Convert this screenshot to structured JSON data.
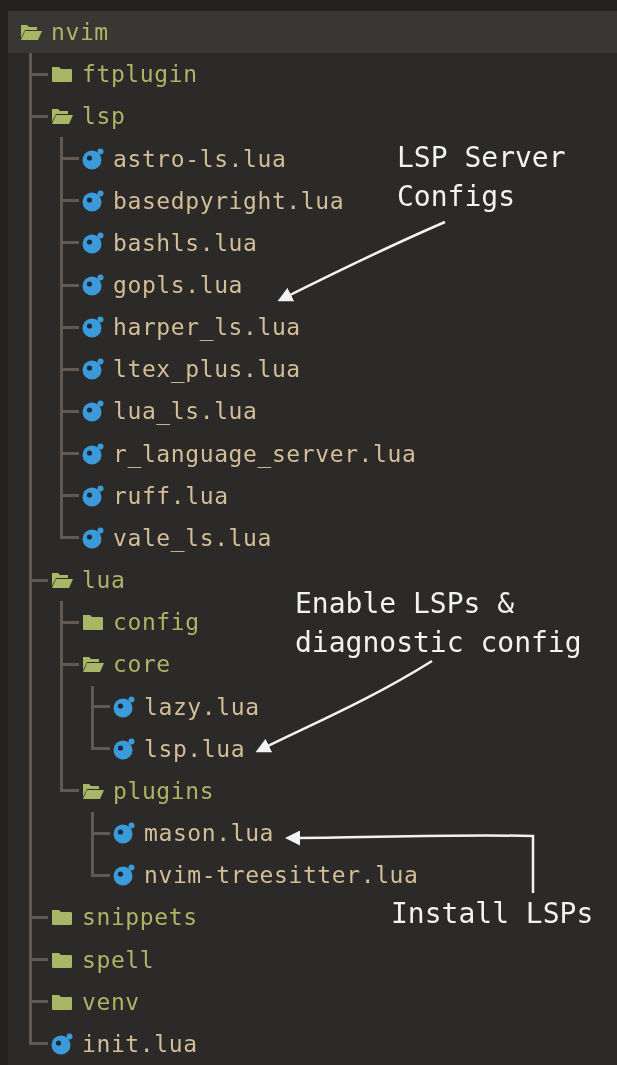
{
  "tree": {
    "name": "nvim",
    "kind": "folder",
    "expanded": true,
    "selected": true,
    "children": [
      {
        "name": "ftplugin",
        "kind": "folder",
        "expanded": false,
        "selected": false
      },
      {
        "name": "lsp",
        "kind": "folder",
        "expanded": true,
        "selected": false,
        "children": [
          {
            "name": "astro-ls.lua",
            "kind": "file",
            "selected": false
          },
          {
            "name": "basedpyright.lua",
            "kind": "file",
            "selected": false
          },
          {
            "name": "bashls.lua",
            "kind": "file",
            "selected": false
          },
          {
            "name": "gopls.lua",
            "kind": "file",
            "selected": false
          },
          {
            "name": "harper_ls.lua",
            "kind": "file",
            "selected": false
          },
          {
            "name": "ltex_plus.lua",
            "kind": "file",
            "selected": false
          },
          {
            "name": "lua_ls.lua",
            "kind": "file",
            "selected": false
          },
          {
            "name": "r_language_server.lua",
            "kind": "file",
            "selected": false
          },
          {
            "name": "ruff.lua",
            "kind": "file",
            "selected": false
          },
          {
            "name": "vale_ls.lua",
            "kind": "file",
            "selected": false
          }
        ]
      },
      {
        "name": "lua",
        "kind": "folder",
        "expanded": true,
        "selected": false,
        "children": [
          {
            "name": "config",
            "kind": "folder",
            "expanded": false,
            "selected": false
          },
          {
            "name": "core",
            "kind": "folder",
            "expanded": true,
            "selected": false,
            "children": [
              {
                "name": "lazy.lua",
                "kind": "file",
                "selected": false
              },
              {
                "name": "lsp.lua",
                "kind": "file",
                "selected": false
              }
            ]
          },
          {
            "name": "plugins",
            "kind": "folder",
            "expanded": true,
            "selected": false,
            "children": [
              {
                "name": "mason.lua",
                "kind": "file",
                "selected": false
              },
              {
                "name": "nvim-treesitter.lua",
                "kind": "file",
                "selected": false
              }
            ]
          }
        ]
      },
      {
        "name": "snippets",
        "kind": "folder",
        "expanded": false,
        "selected": false
      },
      {
        "name": "spell",
        "kind": "folder",
        "expanded": false,
        "selected": false
      },
      {
        "name": "venv",
        "kind": "folder",
        "expanded": false,
        "selected": false
      },
      {
        "name": "init.lua",
        "kind": "file",
        "selected": false
      }
    ]
  },
  "annotations": [
    {
      "text": "LSP Server\nConfigs"
    },
    {
      "text": "Enable LSPs &\ndiagnostic config"
    },
    {
      "text": "Install LSPs"
    }
  ]
}
